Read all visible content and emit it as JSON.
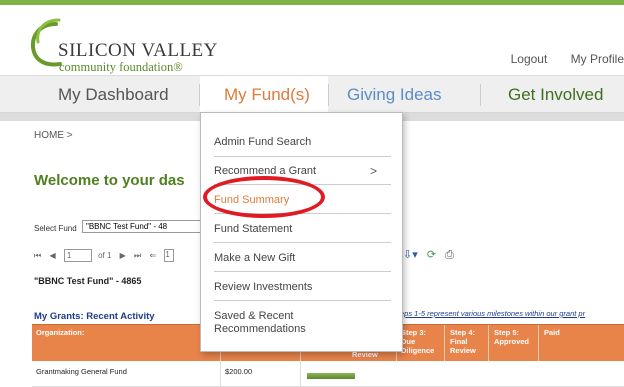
{
  "header": {
    "logo_line1": "SILICON VALLEY",
    "logo_line2": "community foundation",
    "logo_mark": "®",
    "links": [
      "Logout",
      "My Profile"
    ]
  },
  "nav": {
    "items": [
      {
        "label": "My Dashboard",
        "active": false
      },
      {
        "label": "My Fund(s)",
        "active": true
      },
      {
        "label": "Giving Ideas",
        "active": false
      },
      {
        "label": "Get Involved",
        "active": false
      }
    ]
  },
  "dropdown": {
    "items": [
      {
        "label": "Admin Fund Search"
      },
      {
        "label": "Recommend a Grant",
        "submenu": ">"
      },
      {
        "label": "Fund Summary",
        "highlighted": true
      },
      {
        "label": "Fund Statement"
      },
      {
        "label": "Make a New Gift"
      },
      {
        "label": "Review Investments"
      },
      {
        "label": "Saved & Recent Recommendations"
      }
    ]
  },
  "content": {
    "breadcrumb": "HOME >",
    "welcome": "Welcome to your das",
    "select_label": "Select Fund",
    "select_value": "\"BBNC Test Fund\" - 48",
    "pager": {
      "page_value": "1",
      "of_text": "of 1",
      "zoom_value": "1"
    },
    "fund_name": "\"BBNC Test Fund\" - 4865",
    "grants_title": "My Grants: Recent Activity",
    "grants_note": "eps 1-5 represent various milestones within our grant pr"
  },
  "table": {
    "headers": [
      {
        "label": "Organization:"
      },
      {
        "label": "Review"
      },
      {
        "label": "Step 3: Due Diligence"
      },
      {
        "label": "Step 4: Final Review"
      },
      {
        "label": "Step 5: Approved"
      },
      {
        "label": "Paid"
      }
    ],
    "rows": [
      {
        "organization": "Grantmaking General Fund",
        "amount": "$200.00"
      }
    ]
  },
  "colors": {
    "brand_green": "#4f7f1f",
    "nav_active_text": "#e07b3a",
    "nav_blue": "#5b8dc7",
    "nav_green": "#3f6f1f",
    "table_header": "#e8834a",
    "highlight_ring": "#e01b24"
  }
}
